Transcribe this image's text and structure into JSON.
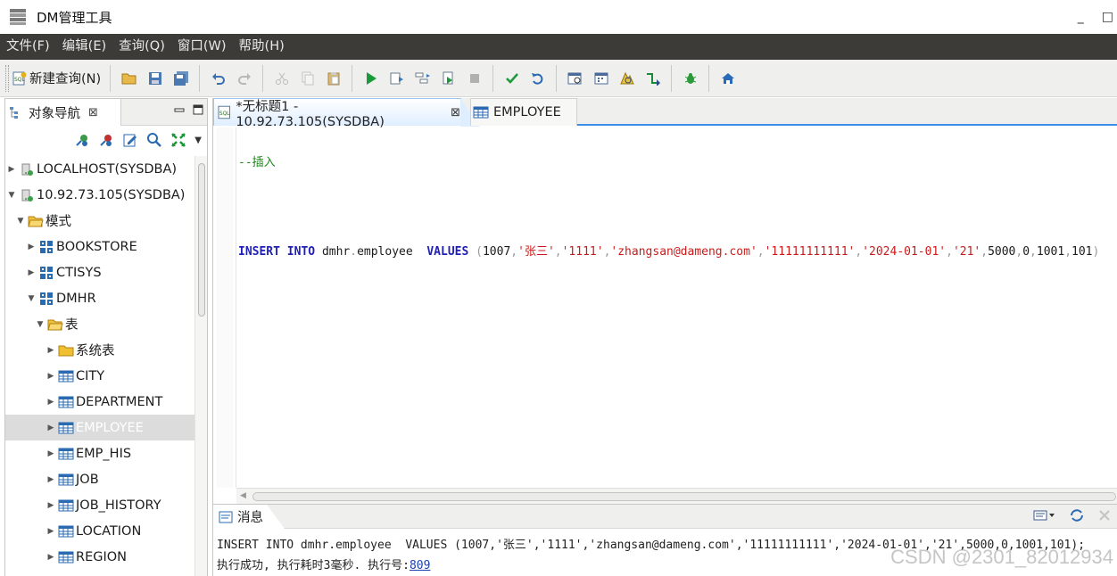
{
  "window": {
    "title": "DM管理工具",
    "minimize": "_",
    "restore": "□"
  },
  "menu": [
    "文件(F)",
    "编辑(E)",
    "查询(Q)",
    "窗口(W)",
    "帮助(H)"
  ],
  "toolbar": {
    "new_query_label": "新建查询(N)"
  },
  "navigator": {
    "tab_label": "对象导航",
    "tab_close": "⊠",
    "tree": [
      {
        "label": "LOCALHOST(SYSDBA)",
        "level": 0,
        "expanded": false,
        "icon": "server-icon"
      },
      {
        "label": "10.92.73.105(SYSDBA)",
        "level": 0,
        "expanded": true,
        "icon": "server-icon"
      },
      {
        "label": "模式",
        "level": 1,
        "expanded": true,
        "icon": "folder-open-icon"
      },
      {
        "label": "BOOKSTORE",
        "level": 2,
        "expanded": false,
        "icon": "schema-icon"
      },
      {
        "label": "CTISYS",
        "level": 2,
        "expanded": false,
        "icon": "schema-icon"
      },
      {
        "label": "DMHR",
        "level": 2,
        "expanded": true,
        "icon": "schema-icon"
      },
      {
        "label": "表",
        "level": 3,
        "expanded": true,
        "icon": "folder-open-icon"
      },
      {
        "label": "系统表",
        "level": 4,
        "expanded": false,
        "icon": "folder-icon"
      },
      {
        "label": "CITY",
        "level": 4,
        "expanded": false,
        "icon": "table-icon"
      },
      {
        "label": "DEPARTMENT",
        "level": 4,
        "expanded": false,
        "icon": "table-icon"
      },
      {
        "label": "EMPLOYEE",
        "level": 4,
        "expanded": false,
        "icon": "table-icon",
        "selected": true
      },
      {
        "label": "EMP_HIS",
        "level": 4,
        "expanded": false,
        "icon": "table-icon"
      },
      {
        "label": "JOB",
        "level": 4,
        "expanded": false,
        "icon": "table-icon"
      },
      {
        "label": "JOB_HISTORY",
        "level": 4,
        "expanded": false,
        "icon": "table-icon"
      },
      {
        "label": "LOCATION",
        "level": 4,
        "expanded": false,
        "icon": "table-icon"
      },
      {
        "label": "REGION",
        "level": 4,
        "expanded": false,
        "icon": "table-icon"
      }
    ]
  },
  "editor": {
    "tabs": [
      {
        "label": "*无标题1 - 10.92.73.105(SYSDBA)",
        "close": "⊠"
      },
      {
        "label": "EMPLOYEE"
      }
    ],
    "code": {
      "comment": "--插入",
      "kw_insert": "INSERT",
      "kw_into": "INTO",
      "schema": "dmhr",
      "dot": ".",
      "table": "employee",
      "kw_values": "VALUES",
      "open_paren": "(",
      "v1": "1007",
      "v2": "'张三'",
      "v3": "'1111'",
      "v4": "'zhangsan@dameng.com'",
      "v5": "'11111111111'",
      "v6": "'2024-01-01'",
      "v7": "'21'",
      "v8": "5000",
      "v9": "0",
      "v10": "1001",
      "v11": "101",
      "close_paren": ")",
      "comma": ","
    }
  },
  "messages": {
    "tab_label": "消息",
    "line1": "INSERT INTO dmhr.employee  VALUES (1007,'张三','1111','zhangsan@dameng.com','11111111111','2024-01-01','21',5000,0,1001,101);",
    "line2_prefix": "执行成功, 执行耗时3毫秒. 执行号:",
    "exec_no": "809"
  },
  "watermark": "CSDN @2301_82012934"
}
